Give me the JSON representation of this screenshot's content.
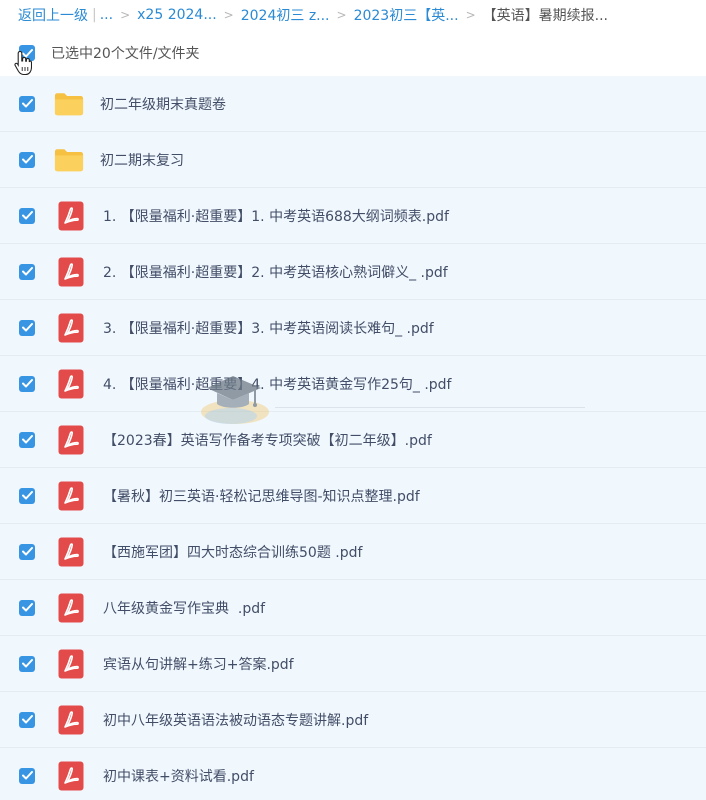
{
  "breadcrumb": {
    "back_label": "返回上一级",
    "pipe": "|",
    "ellipsis": "...",
    "sep": ">",
    "crumbs": [
      "x25 2024...",
      "2024初三 z...",
      "2023初三【英..."
    ],
    "current": "【英语】暑期续报..."
  },
  "selection": {
    "text": "已选中20个文件/文件夹"
  },
  "files": [
    {
      "name": "初二年级期末真题卷",
      "type": "folder"
    },
    {
      "name": "初二期末复习",
      "type": "folder"
    },
    {
      "name": "1. 【限量福利·超重要】1. 中考英语688大纲词频表.pdf",
      "type": "pdf"
    },
    {
      "name": "2. 【限量福利·超重要】2. 中考英语核心熟词僻义_ .pdf",
      "type": "pdf"
    },
    {
      "name": "3. 【限量福利·超重要】3. 中考英语阅读长难句_ .pdf",
      "type": "pdf"
    },
    {
      "name": "4. 【限量福利·超重要】4. 中考英语黄金写作25句_ .pdf",
      "type": "pdf"
    },
    {
      "name": "【2023春】英语写作备考专项突破【初二年级】.pdf",
      "type": "pdf"
    },
    {
      "name": "【暑秋】初三英语·轻松记思维导图-知识点整理.pdf",
      "type": "pdf"
    },
    {
      "name": "【西施军团】四大时态综合训练50题 .pdf",
      "type": "pdf"
    },
    {
      "name": "八年级黄金写作宝典  .pdf",
      "type": "pdf"
    },
    {
      "name": "宾语从句讲解+练习+答案.pdf",
      "type": "pdf"
    },
    {
      "name": "初中八年级英语语法被动语态专题讲解.pdf",
      "type": "pdf"
    },
    {
      "name": "初中课表+资料试看.pdf",
      "type": "pdf"
    }
  ],
  "colors": {
    "link": "#2a8ad4",
    "checkbox": "#3795e4",
    "row_bg": "#f0f7fd",
    "folder": "#f8c74a",
    "pdf": "#e34a4a"
  }
}
